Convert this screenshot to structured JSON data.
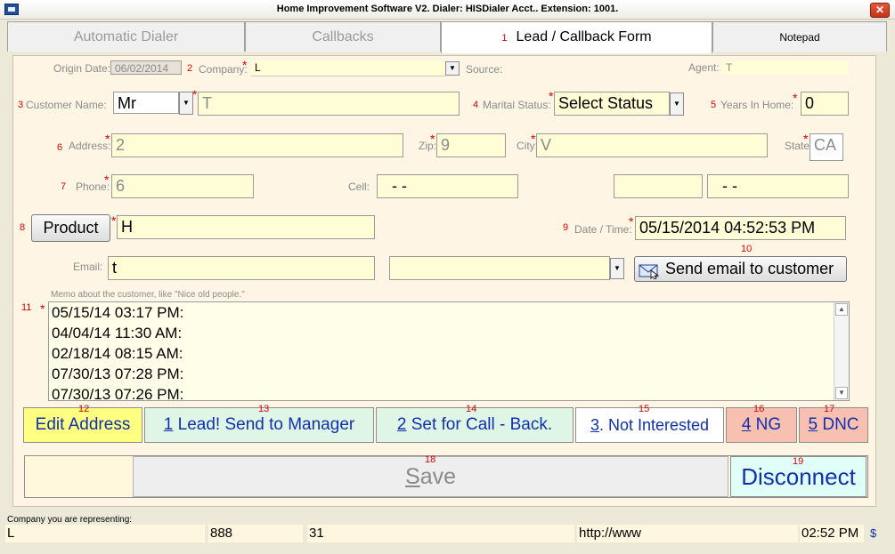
{
  "window": {
    "title": "Home Improvement Software V2. Dialer: HISDialer Acct.. Extension: 1001.",
    "close_glyph": "✕"
  },
  "tabs": [
    {
      "label": "Automatic Dialer",
      "number": ""
    },
    {
      "label": "Callbacks",
      "number": ""
    },
    {
      "label": "Lead / Callback Form",
      "number": "1"
    },
    {
      "label": "Notepad",
      "number": ""
    }
  ],
  "form": {
    "origin_date_label": "Origin Date:",
    "origin_date_value": "06/02/2014",
    "company_num": "2",
    "company_label": "Company:",
    "company_value": "L",
    "source_label": "Source:",
    "agent_label": "Agent:",
    "agent_value": "T",
    "customer_name_num": "3",
    "customer_name_label": "Customer Name:",
    "salutation_value": "Mr",
    "customer_name_value": "T",
    "marital_num": "4",
    "marital_label": "Marital Status:",
    "marital_value": "Select Status",
    "years_num": "5",
    "years_label": "Years In Home:",
    "years_value": "0",
    "address_num": "6",
    "address_label": "Address:",
    "address_value": "2",
    "zip_label": "Zip:",
    "zip_value": "9",
    "city_label": "City:",
    "city_value": "V",
    "state_label": "State:",
    "state_value": "CA",
    "phone_num": "7",
    "phone_label": "Phone:",
    "phone_value": "6",
    "cell_label": "Cell:",
    "cell_value": "-  -",
    "other_phone_value": "-  -",
    "product_num": "8",
    "product_button": "Product",
    "product_value": "H",
    "datetime_num": "9",
    "datetime_label": "Date / Time:",
    "datetime_value": "05/15/2014 04:52:53 PM",
    "email_label": "Email:",
    "email_value": "t",
    "send_email_num": "10",
    "send_email_button": "Send email to customer",
    "memo_num": "11",
    "memo_hint": "Memo about the customer, like \"Nice old people.\"",
    "memo_lines": [
      "05/15/14 03:17 PM:",
      "04/04/14 11:30 AM:",
      "02/18/14 08:15 AM:",
      "07/30/13 07:28 PM:",
      "07/30/13 07:26 PM:"
    ]
  },
  "actions": {
    "edit_address": {
      "num": "12",
      "label": "Edit Address"
    },
    "lead_manager": {
      "num": "13",
      "key": "1",
      "label": " Lead! Send to Manager"
    },
    "callback": {
      "num": "14",
      "key": "2",
      "label": " Set for Call - Back."
    },
    "not_interested": {
      "num": "15",
      "key": "3",
      "label": ". Not Interested"
    },
    "ng": {
      "num": "16",
      "key": "4",
      "label": " NG"
    },
    "dnc": {
      "num": "17",
      "key": "5",
      "label": " DNC"
    },
    "save": {
      "num": "18",
      "key": "S",
      "label": "ave"
    },
    "disconnect": {
      "num": "19",
      "label": "Disconnect"
    }
  },
  "status": {
    "company_label": "Company you are representing:",
    "company": "L",
    "phone1": "888",
    "field3": "31",
    "url": "http://www",
    "time": "02:52 PM",
    "currency_glyph": "$"
  },
  "colors": {
    "field_bg": "#FFFDD6",
    "panel_bg": "#FFF5E5",
    "required_red": "#E00000",
    "link_blue": "#1030B0"
  }
}
